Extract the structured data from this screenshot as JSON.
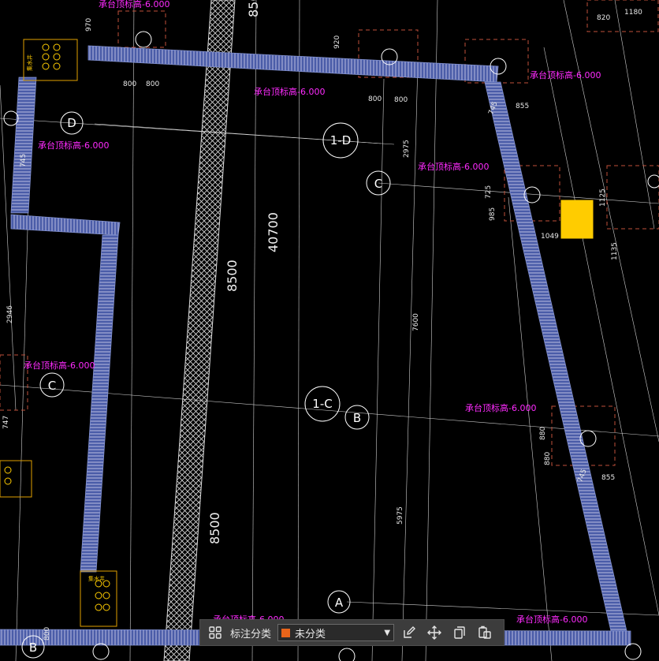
{
  "drawing": {
    "elevation_label": "承台顶标高-6.000",
    "axis_labels": [
      "D",
      "C",
      "C",
      "B",
      "A",
      "B"
    ],
    "sub_axis_labels": [
      "1-D",
      "1-C"
    ],
    "big_dims": [
      "8500",
      "40700",
      "8500"
    ],
    "dims": [
      "800",
      "800",
      "800",
      "800",
      "855",
      "745",
      "745",
      "855",
      "2975",
      "7600",
      "5975",
      "2946",
      "725",
      "985",
      "1049",
      "1135",
      "880",
      "1125",
      "920",
      "970",
      "820",
      "1180",
      "880",
      "745",
      "747",
      "800"
    ],
    "pile_cap_label": "集水井",
    "colors": {
      "wall": "#4a5ca8",
      "wall_hatch": "#c8c8e8",
      "elevation": "#ff2bff",
      "axis": "#ffffff",
      "dashed": "#c0503a",
      "pile": "#ffcc00"
    }
  },
  "toolbar": {
    "grid_icon": "grid-icon",
    "label": "标注分类",
    "select_value": "未分类",
    "select_color": "#e8641a",
    "icons": [
      "edit-icon",
      "move-icon",
      "copy-icon",
      "paste-icon"
    ]
  }
}
